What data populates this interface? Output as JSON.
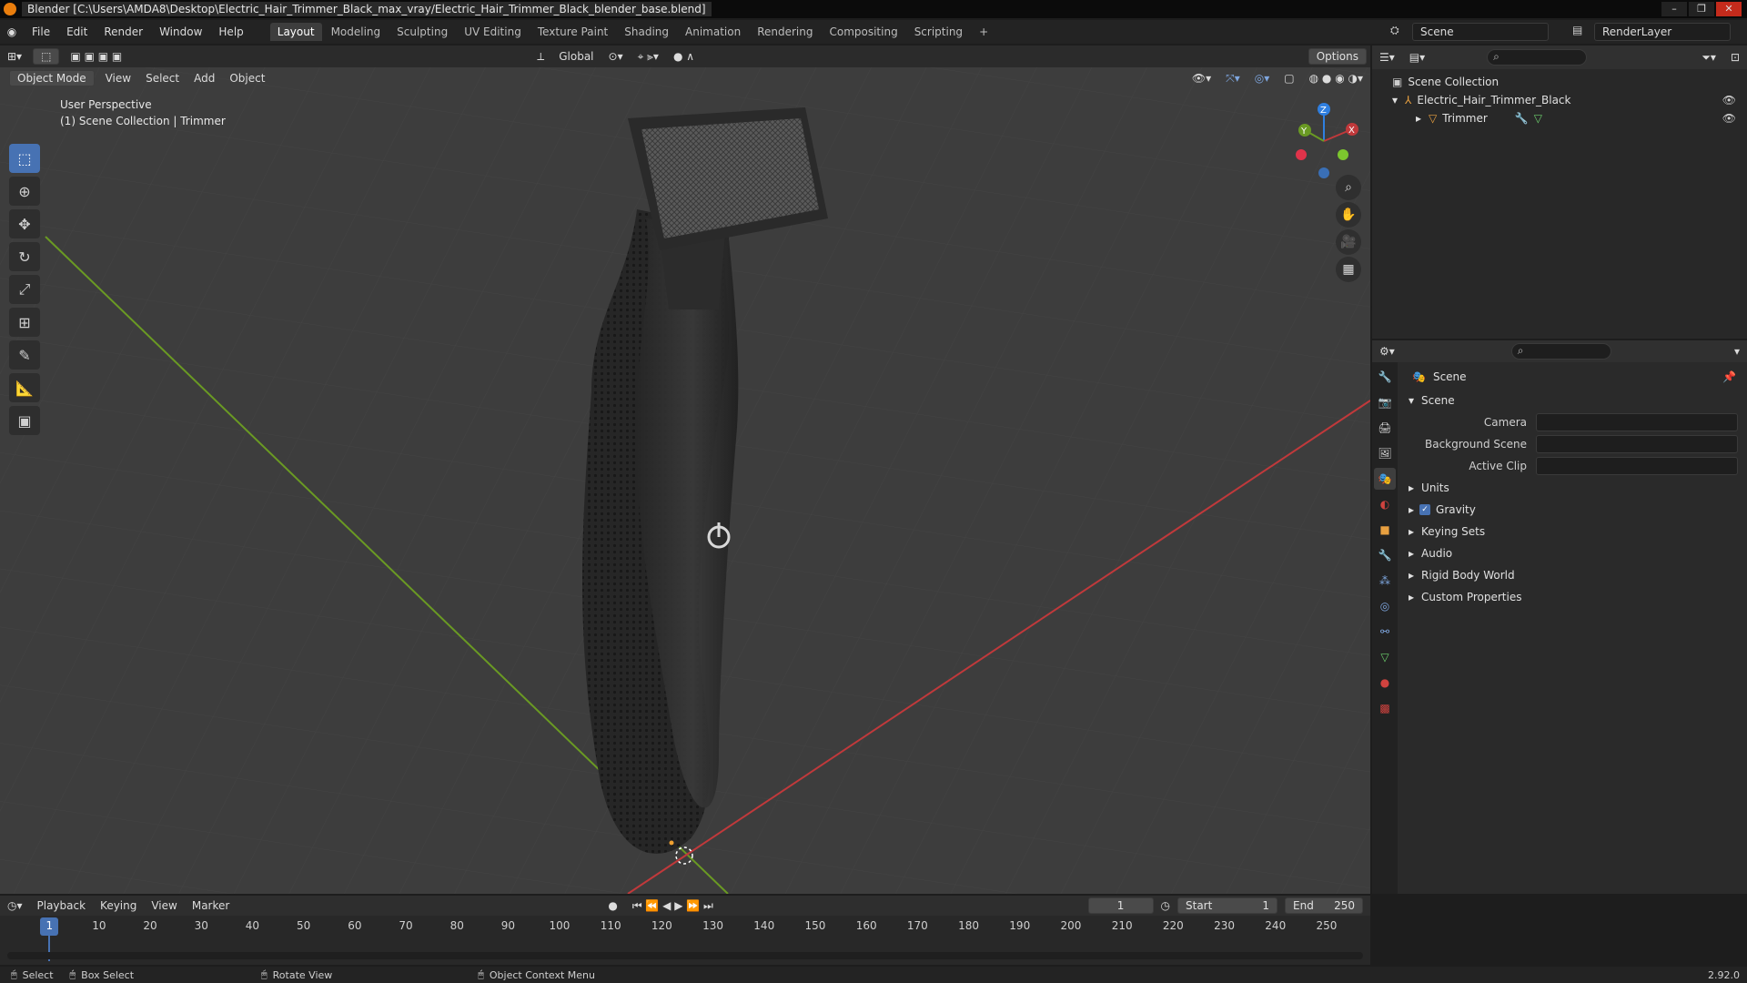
{
  "window": {
    "title": "Blender [C:\\Users\\AMDA8\\Desktop\\Electric_Hair_Trimmer_Black_max_vray/Electric_Hair_Trimmer_Black_blender_base.blend]",
    "buttons": [
      "–",
      "❐",
      "✕"
    ]
  },
  "menubar": {
    "items": [
      "File",
      "Edit",
      "Render",
      "Window",
      "Help"
    ],
    "workspaces": [
      "Layout",
      "Modeling",
      "Sculpting",
      "UV Editing",
      "Texture Paint",
      "Shading",
      "Animation",
      "Rendering",
      "Compositing",
      "Scripting"
    ],
    "add_tab": "+",
    "scene": "Scene",
    "render_layer": "RenderLayer"
  },
  "viewport": {
    "transform_orientation": "Global",
    "options": "Options",
    "mode": "Object Mode",
    "menu": [
      "View",
      "Select",
      "Add",
      "Object"
    ],
    "perspective": "User Perspective",
    "collection_info": "(1) Scene Collection | Trimmer",
    "gizmo": {
      "x": "X",
      "y": "Y",
      "z": "Z"
    }
  },
  "outliner": {
    "root": "Scene Collection",
    "items": [
      "Electric_Hair_Trimmer_Black",
      "Trimmer"
    ]
  },
  "properties": {
    "context": "Scene",
    "section": "Scene",
    "fields": [
      "Camera",
      "Background Scene",
      "Active Clip"
    ],
    "panels": [
      "Units",
      "Gravity",
      "Keying Sets",
      "Audio",
      "Rigid Body World",
      "Custom Properties"
    ]
  },
  "timeline": {
    "menu": [
      "Playback",
      "Keying",
      "View",
      "Marker"
    ],
    "current_frame": "1",
    "start_label": "Start",
    "start": "1",
    "end_label": "End",
    "end": "250",
    "ticks": [
      "1",
      "10",
      "20",
      "30",
      "40",
      "50",
      "60",
      "70",
      "80",
      "90",
      "100",
      "110",
      "120",
      "130",
      "140",
      "150",
      "160",
      "170",
      "180",
      "190",
      "200",
      "210",
      "220",
      "230",
      "240",
      "250"
    ]
  },
  "statusbar": {
    "select": "Select",
    "box_select": "Box Select",
    "rotate_view": "Rotate View",
    "context_menu": "Object Context Menu",
    "version": "2.92.0"
  },
  "colors": {
    "accent": "#4772b3",
    "x_axis": "#c0393b",
    "y_axis": "#6a9a23",
    "z_axis": "#2f7fe0"
  }
}
